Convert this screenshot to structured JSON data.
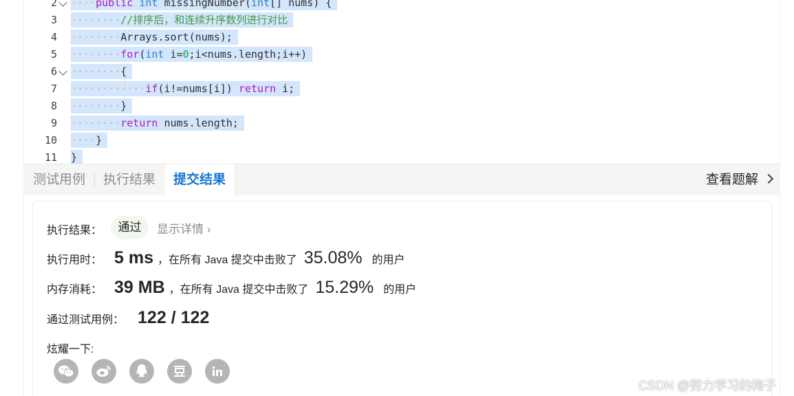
{
  "editor": {
    "lines": [
      {
        "num": "2",
        "fold": true,
        "dots": "····",
        "tokens": [
          [
            "c-kw",
            "public"
          ],
          [
            "c-plain",
            " "
          ],
          [
            "c-type",
            "int"
          ],
          [
            "c-plain",
            " missingNumber("
          ],
          [
            "c-type",
            "int"
          ],
          [
            "c-plain",
            "[] nums) {"
          ]
        ]
      },
      {
        "num": "3",
        "fold": false,
        "dots": "········",
        "tokens": [
          [
            "c-comment",
            "//排序后，和连续升序数列进行对比"
          ]
        ]
      },
      {
        "num": "4",
        "fold": false,
        "dots": "········",
        "tokens": [
          [
            "c-plain",
            "Arrays.sort(nums);"
          ]
        ]
      },
      {
        "num": "5",
        "fold": false,
        "dots": "········",
        "tokens": [
          [
            "c-kw",
            "for"
          ],
          [
            "c-plain",
            "("
          ],
          [
            "c-type",
            "int"
          ],
          [
            "c-plain",
            " i="
          ],
          [
            "c-num",
            "0"
          ],
          [
            "c-plain",
            ";i<nums.length;i++)"
          ]
        ]
      },
      {
        "num": "6",
        "fold": true,
        "dots": "········",
        "tokens": [
          [
            "c-plain",
            "{"
          ]
        ]
      },
      {
        "num": "7",
        "fold": false,
        "dots": "············",
        "tokens": [
          [
            "c-kw",
            "if"
          ],
          [
            "c-plain",
            "(i!=nums[i]) "
          ],
          [
            "c-kw",
            "return"
          ],
          [
            "c-plain",
            " i;"
          ]
        ]
      },
      {
        "num": "8",
        "fold": false,
        "dots": "········",
        "tokens": [
          [
            "c-plain",
            "}"
          ]
        ]
      },
      {
        "num": "9",
        "fold": false,
        "dots": "········",
        "tokens": [
          [
            "c-kw",
            "return"
          ],
          [
            "c-plain",
            " nums.length;"
          ]
        ]
      },
      {
        "num": "10",
        "fold": false,
        "dots": "····",
        "tokens": [
          [
            "c-plain",
            "}"
          ]
        ]
      },
      {
        "num": "11",
        "fold": false,
        "dots": "",
        "tokens": [
          [
            "c-plain",
            "}"
          ]
        ]
      }
    ]
  },
  "tabs": {
    "test_cases": "测试用例",
    "run_result": "执行结果",
    "submit_result": "提交结果",
    "view_solution": "查看题解"
  },
  "result": {
    "status_label": "执行结果：",
    "status_value": "通过",
    "details_link": "显示详情 ›",
    "runtime_label": "执行用时：",
    "runtime_value": "5 ms",
    "runtime_text": "，在所有 Java 提交中击败了",
    "runtime_pct": "35.08%",
    "runtime_suffix": "的用户",
    "memory_label": "内存消耗：",
    "memory_value": "39 MB",
    "memory_text": "，在所有 Java 提交中击败了",
    "memory_pct": "15.29%",
    "memory_suffix": "的用户",
    "cases_label": "通过测试用例：",
    "cases_value": "122 / 122",
    "share_label": "炫耀一下:"
  },
  "share_icons": [
    "wechat-icon",
    "weibo-icon",
    "qq-icon",
    "douban-icon",
    "linkedin-icon"
  ],
  "watermark": "CSDN @努力学习的梅子"
}
